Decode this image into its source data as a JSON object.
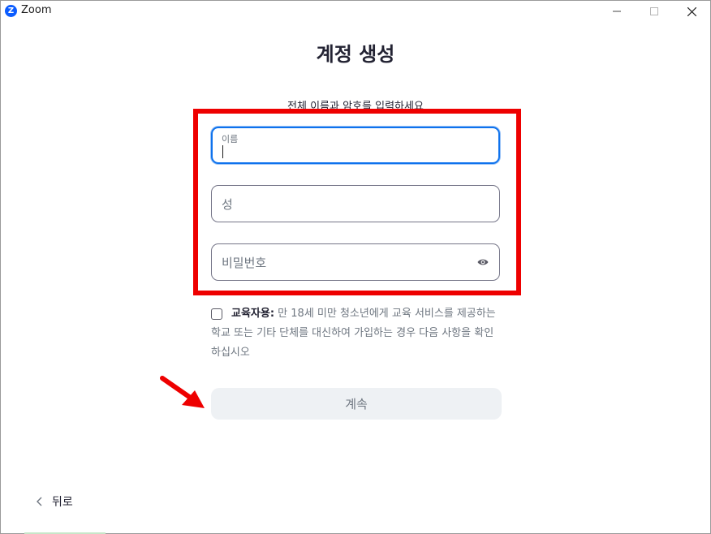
{
  "window": {
    "title": "Zoom",
    "logo_letter": "Z",
    "icons": [
      "minimize-icon",
      "maximize-icon",
      "close-icon"
    ]
  },
  "page": {
    "heading": "계정 생성",
    "subheading": "전체 이름과 암호를 입력하세요"
  },
  "form": {
    "first_name": {
      "label": "이름",
      "value": ""
    },
    "last_name": {
      "placeholder": "성"
    },
    "password": {
      "placeholder": "비밀번호",
      "icon": "eye-icon"
    }
  },
  "education": {
    "checked": false,
    "label_bold": "교육자용:",
    "label_text": " 만 18세 미만 청소년에게 교육 서비스를 제공하는 학교 또는 기타 단체를 대신하여 가입하는 경우 다음 사항을 확인하십시오"
  },
  "actions": {
    "continue_label": "계속",
    "back_label": "뒤로"
  },
  "colors": {
    "brand": "#0b5cff",
    "focus_border": "#0e72ed",
    "annotation_red": "#ee0000",
    "button_bg": "#eef1f4"
  }
}
